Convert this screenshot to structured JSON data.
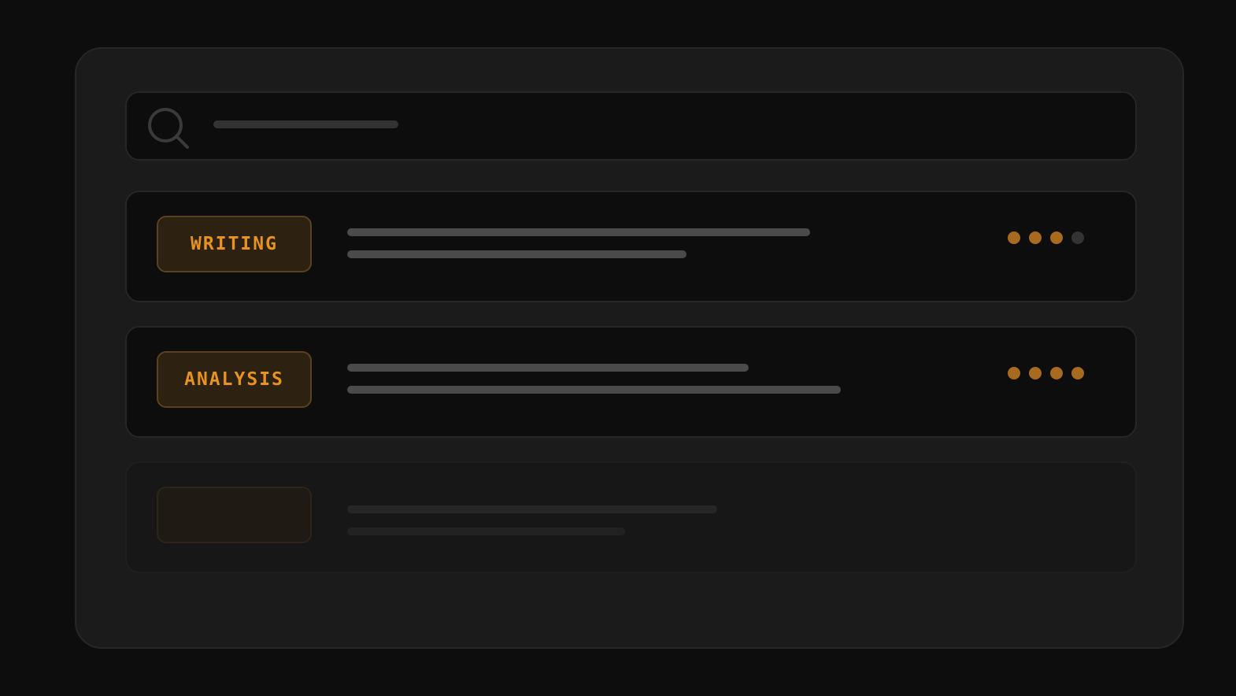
{
  "search": {
    "icon": "search-icon",
    "placeholder": ""
  },
  "colors": {
    "accent": "#e8921f",
    "dot_active": "#a76a1e",
    "dot_inactive": "#333333",
    "panel_bg": "#1b1b1b",
    "card_bg": "#0d0d0d"
  },
  "cards": [
    {
      "tag": "WRITING",
      "rating": 3,
      "rating_max": 4
    },
    {
      "tag": "ANALYSIS",
      "rating": 4,
      "rating_max": 4
    },
    {
      "tag": "",
      "rating": null,
      "rating_max": null
    }
  ]
}
